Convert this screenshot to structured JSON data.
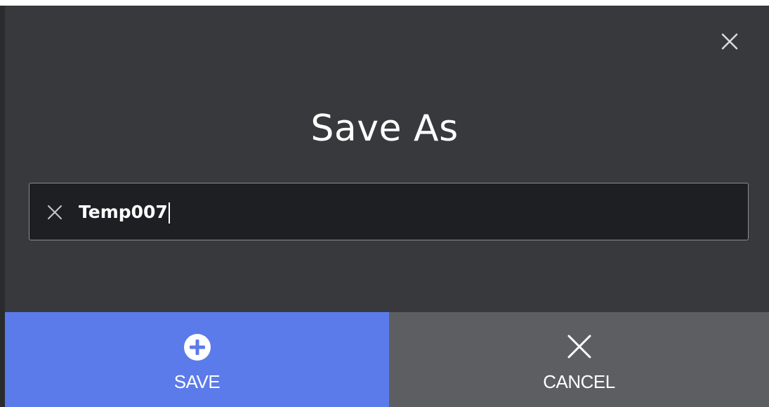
{
  "dialog": {
    "title": "Save As",
    "close_icon": "close-icon"
  },
  "filename_input": {
    "value": "Temp007",
    "clear_icon": "clear-x-icon"
  },
  "actions": {
    "save_label": "SAVE",
    "save_icon": "plus-circle-icon",
    "cancel_label": "CANCEL",
    "cancel_icon": "close-icon"
  },
  "colors": {
    "dialog_bg": "#38393d",
    "input_bg": "#1e1f22",
    "save_bg": "#5c7bea",
    "cancel_bg": "#5c5e62"
  }
}
